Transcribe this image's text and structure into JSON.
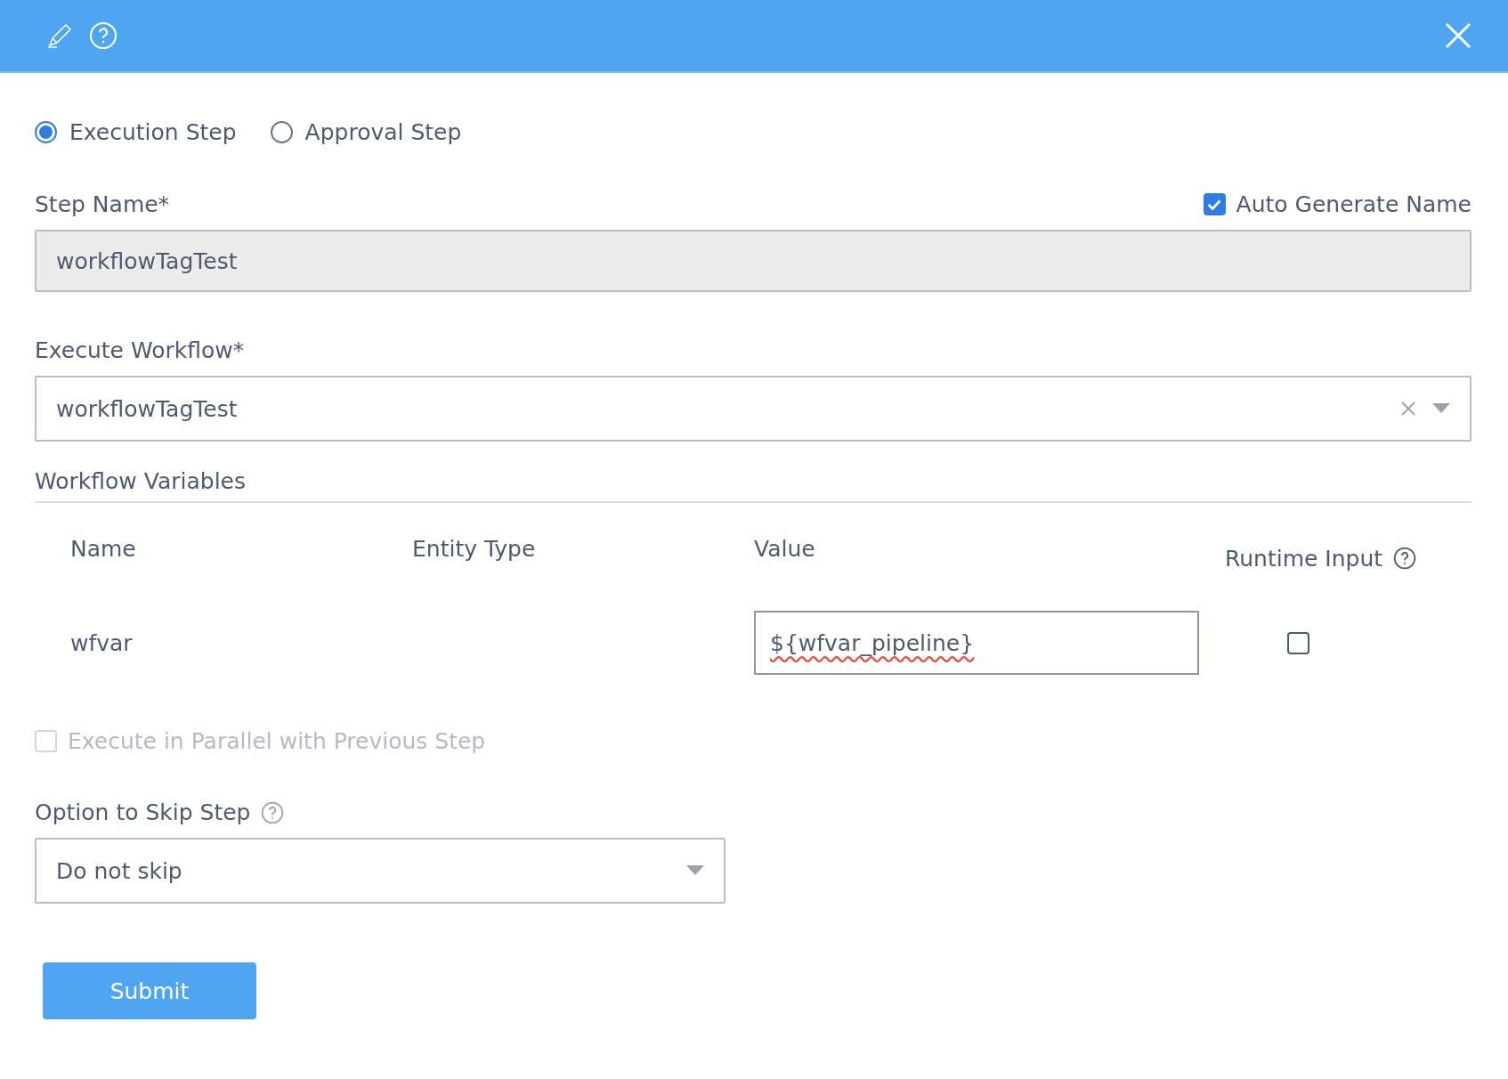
{
  "step_types": [
    {
      "label": "Execution Step",
      "selected": true
    },
    {
      "label": "Approval Step",
      "selected": false
    }
  ],
  "step_name": {
    "label": "Step Name*",
    "value": "workflowTagTest",
    "auto_generate": {
      "label": "Auto Generate Name",
      "checked": true
    }
  },
  "execute_workflow": {
    "label": "Execute Workflow*",
    "value": "workflowTagTest"
  },
  "workflow_variables": {
    "title": "Workflow Variables",
    "columns": [
      "Name",
      "Entity Type",
      "Value",
      "Runtime Input"
    ],
    "rows": [
      {
        "name": "wfvar",
        "value": "${wfvar_pipeline}",
        "runtime_input": false
      }
    ]
  },
  "parallel": {
    "label": "Execute in Parallel with Previous Step",
    "checked": false,
    "disabled": true
  },
  "skip_option": {
    "label": "Option to Skip Step",
    "value": "Do not skip"
  },
  "submit": "Submit"
}
